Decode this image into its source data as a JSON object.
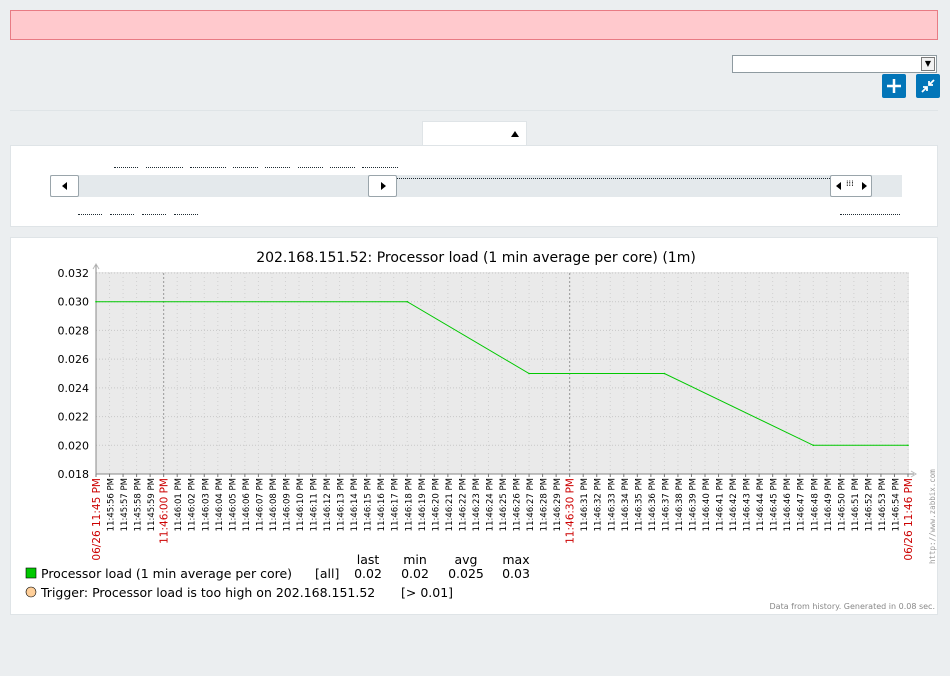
{
  "graph": {
    "title": "202.168.151.52: Processor load (1 min average per core) (1m)",
    "colors": {
      "series": "#00c800",
      "trigger": "#ffcf99",
      "grid_bg": "#eaeaea",
      "red_label": "#cc0000"
    },
    "watermark": "http://www.zabbix.com",
    "footer": "Data from history. Generated in 0.08 sec."
  },
  "legend": {
    "headers": {
      "last": "last",
      "min": "min",
      "avg": "avg",
      "max": "max"
    },
    "items": [
      {
        "name": "Processor load (1 min average per core)",
        "func": "[all]",
        "last": "0.02",
        "min": "0.02",
        "avg": "0.025",
        "max": "0.03",
        "color": "#00c800"
      }
    ],
    "trigger": {
      "text": "Trigger: Processor load is too high on 202.168.151.52",
      "threshold": "[> 0.01]",
      "color": "#ffcf99"
    }
  },
  "chart_data": {
    "type": "line",
    "title": "202.168.151.52: Processor load (1 min average per core) (1m)",
    "xlabel": "",
    "ylabel": "",
    "ylim": [
      0.018,
      0.032
    ],
    "y_ticks": [
      "0.018",
      "0.020",
      "0.022",
      "0.024",
      "0.026",
      "0.028",
      "0.030",
      "0.032"
    ],
    "grid": true,
    "legend_position": "bottom-left",
    "x_labels": [
      "06/26 11:45 PM",
      "11:45:56 PM",
      "11:45:57 PM",
      "11:45:58 PM",
      "11:45:59 PM",
      "11:46:00 PM",
      "11:46:01 PM",
      "11:46:02 PM",
      "11:46:03 PM",
      "11:46:04 PM",
      "11:46:05 PM",
      "11:46:06 PM",
      "11:46:07 PM",
      "11:46:08 PM",
      "11:46:09 PM",
      "11:46:10 PM",
      "11:46:11 PM",
      "11:46:12 PM",
      "11:46:13 PM",
      "11:46:14 PM",
      "11:46:15 PM",
      "11:46:16 PM",
      "11:46:17 PM",
      "11:46:18 PM",
      "11:46:19 PM",
      "11:46:20 PM",
      "11:46:21 PM",
      "11:46:22 PM",
      "11:46:23 PM",
      "11:46:24 PM",
      "11:46:25 PM",
      "11:46:26 PM",
      "11:46:27 PM",
      "11:46:28 PM",
      "11:46:29 PM",
      "11:46:30 PM",
      "11:46:31 PM",
      "11:46:32 PM",
      "11:46:33 PM",
      "11:46:34 PM",
      "11:46:35 PM",
      "11:46:36 PM",
      "11:46:37 PM",
      "11:46:38 PM",
      "11:46:39 PM",
      "11:46:40 PM",
      "11:46:41 PM",
      "11:46:42 PM",
      "11:46:43 PM",
      "11:46:44 PM",
      "11:46:45 PM",
      "11:46:46 PM",
      "11:46:47 PM",
      "11:46:48 PM",
      "11:46:49 PM",
      "11:46:50 PM",
      "11:46:51 PM",
      "11:46:52 PM",
      "11:46:53 PM",
      "11:46:54 PM",
      "06/26 11:46 PM"
    ],
    "red_labels": [
      "06/26 11:45 PM",
      "11:46:00 PM",
      "11:46:30 PM",
      "06/26 11:46 PM"
    ],
    "series": [
      {
        "name": "Processor load (1 min average per core)",
        "x": [
          "11:45:55 PM",
          "11:46:18 PM",
          "11:46:27 PM",
          "11:46:37 PM",
          "11:46:48 PM",
          "11:46:55 PM"
        ],
        "values": [
          0.03,
          0.03,
          0.025,
          0.025,
          0.02,
          0.02
        ]
      }
    ]
  }
}
